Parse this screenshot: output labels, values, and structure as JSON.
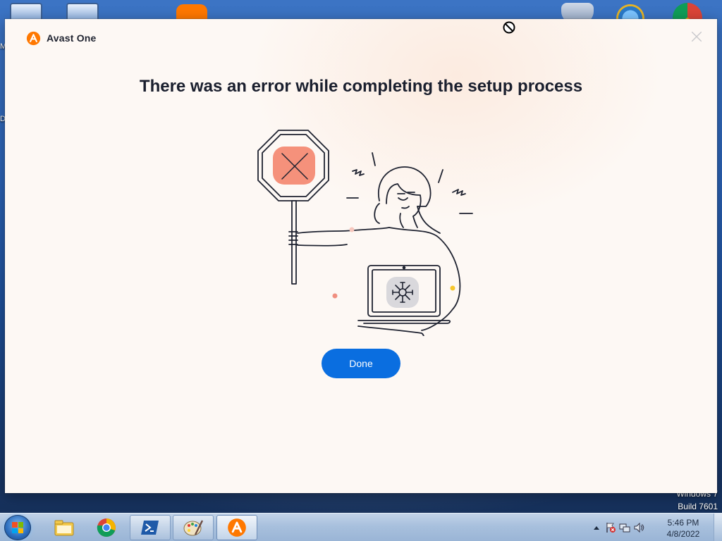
{
  "window": {
    "app_name": "Avast One",
    "headline": "There was an error while completing the setup process",
    "done_label": "Done"
  },
  "desktop": {
    "edge_text": [
      "M",
      "D"
    ],
    "watermark_line1": "Windows 7",
    "watermark_line2": "Build 7601",
    "icons": [
      "computer-icon",
      "network-icon",
      "avast-icon",
      "defender-icon",
      "internet-explorer-icon",
      "chrome-icon"
    ]
  },
  "taskbar": {
    "pinned": [
      "windows-explorer-icon",
      "chrome-icon",
      "powershell-icon",
      "paint-icon",
      "avast-icon"
    ],
    "clock_time": "5:46 PM",
    "clock_date": "4/8/2022"
  },
  "colors": {
    "accent": "#0a6ee0",
    "brand": "#ff7800",
    "dialog_bg": "#fdf8f4",
    "error_sign": "#f4907a"
  }
}
